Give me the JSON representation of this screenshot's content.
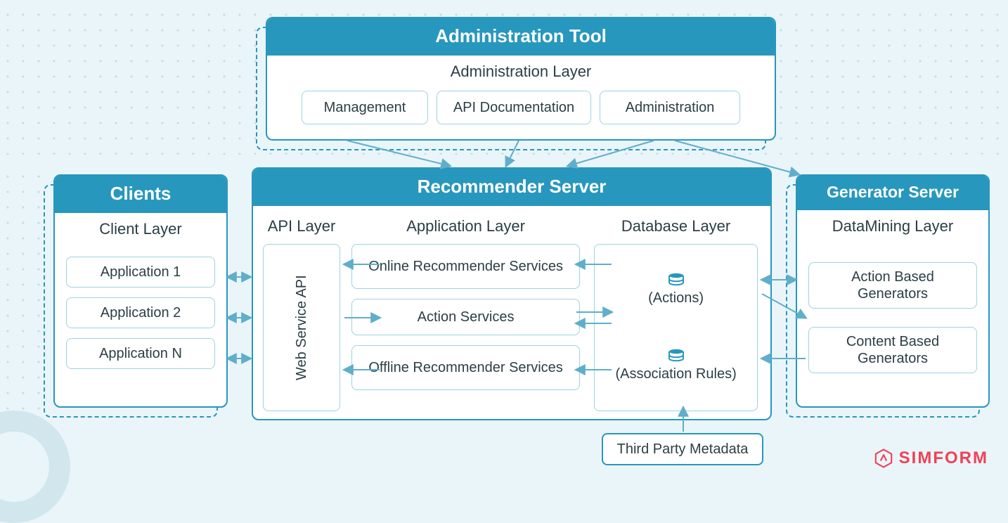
{
  "admin": {
    "title": "Administration Tool",
    "layer": "Administration Layer",
    "items": [
      "Management",
      "API Documentation",
      "Administration"
    ]
  },
  "clients": {
    "title": "Clients",
    "layer": "Client Layer",
    "items": [
      "Application 1",
      "Application 2",
      "Application N"
    ]
  },
  "recommender": {
    "title": "Recommender Server",
    "api_layer": "API Layer",
    "api_box": "Web Service API",
    "app_layer": "Application Layer",
    "app_items": [
      "Online Recommender Services",
      "Action Services",
      "Offline Recommender Services"
    ],
    "db_layer": "Database Layer",
    "db_actions": "(Actions)",
    "db_rules": "(Association Rules)"
  },
  "generator": {
    "title": "Generator Server",
    "layer": "DataMining Layer",
    "items": [
      "Action Based Generators",
      "Content Based Generators"
    ]
  },
  "third_party": "Third Party Metadata",
  "brand": "SIMFORM",
  "colors": {
    "accent": "#2797bd",
    "brand": "#ef4257",
    "text": "#2c3e44"
  }
}
